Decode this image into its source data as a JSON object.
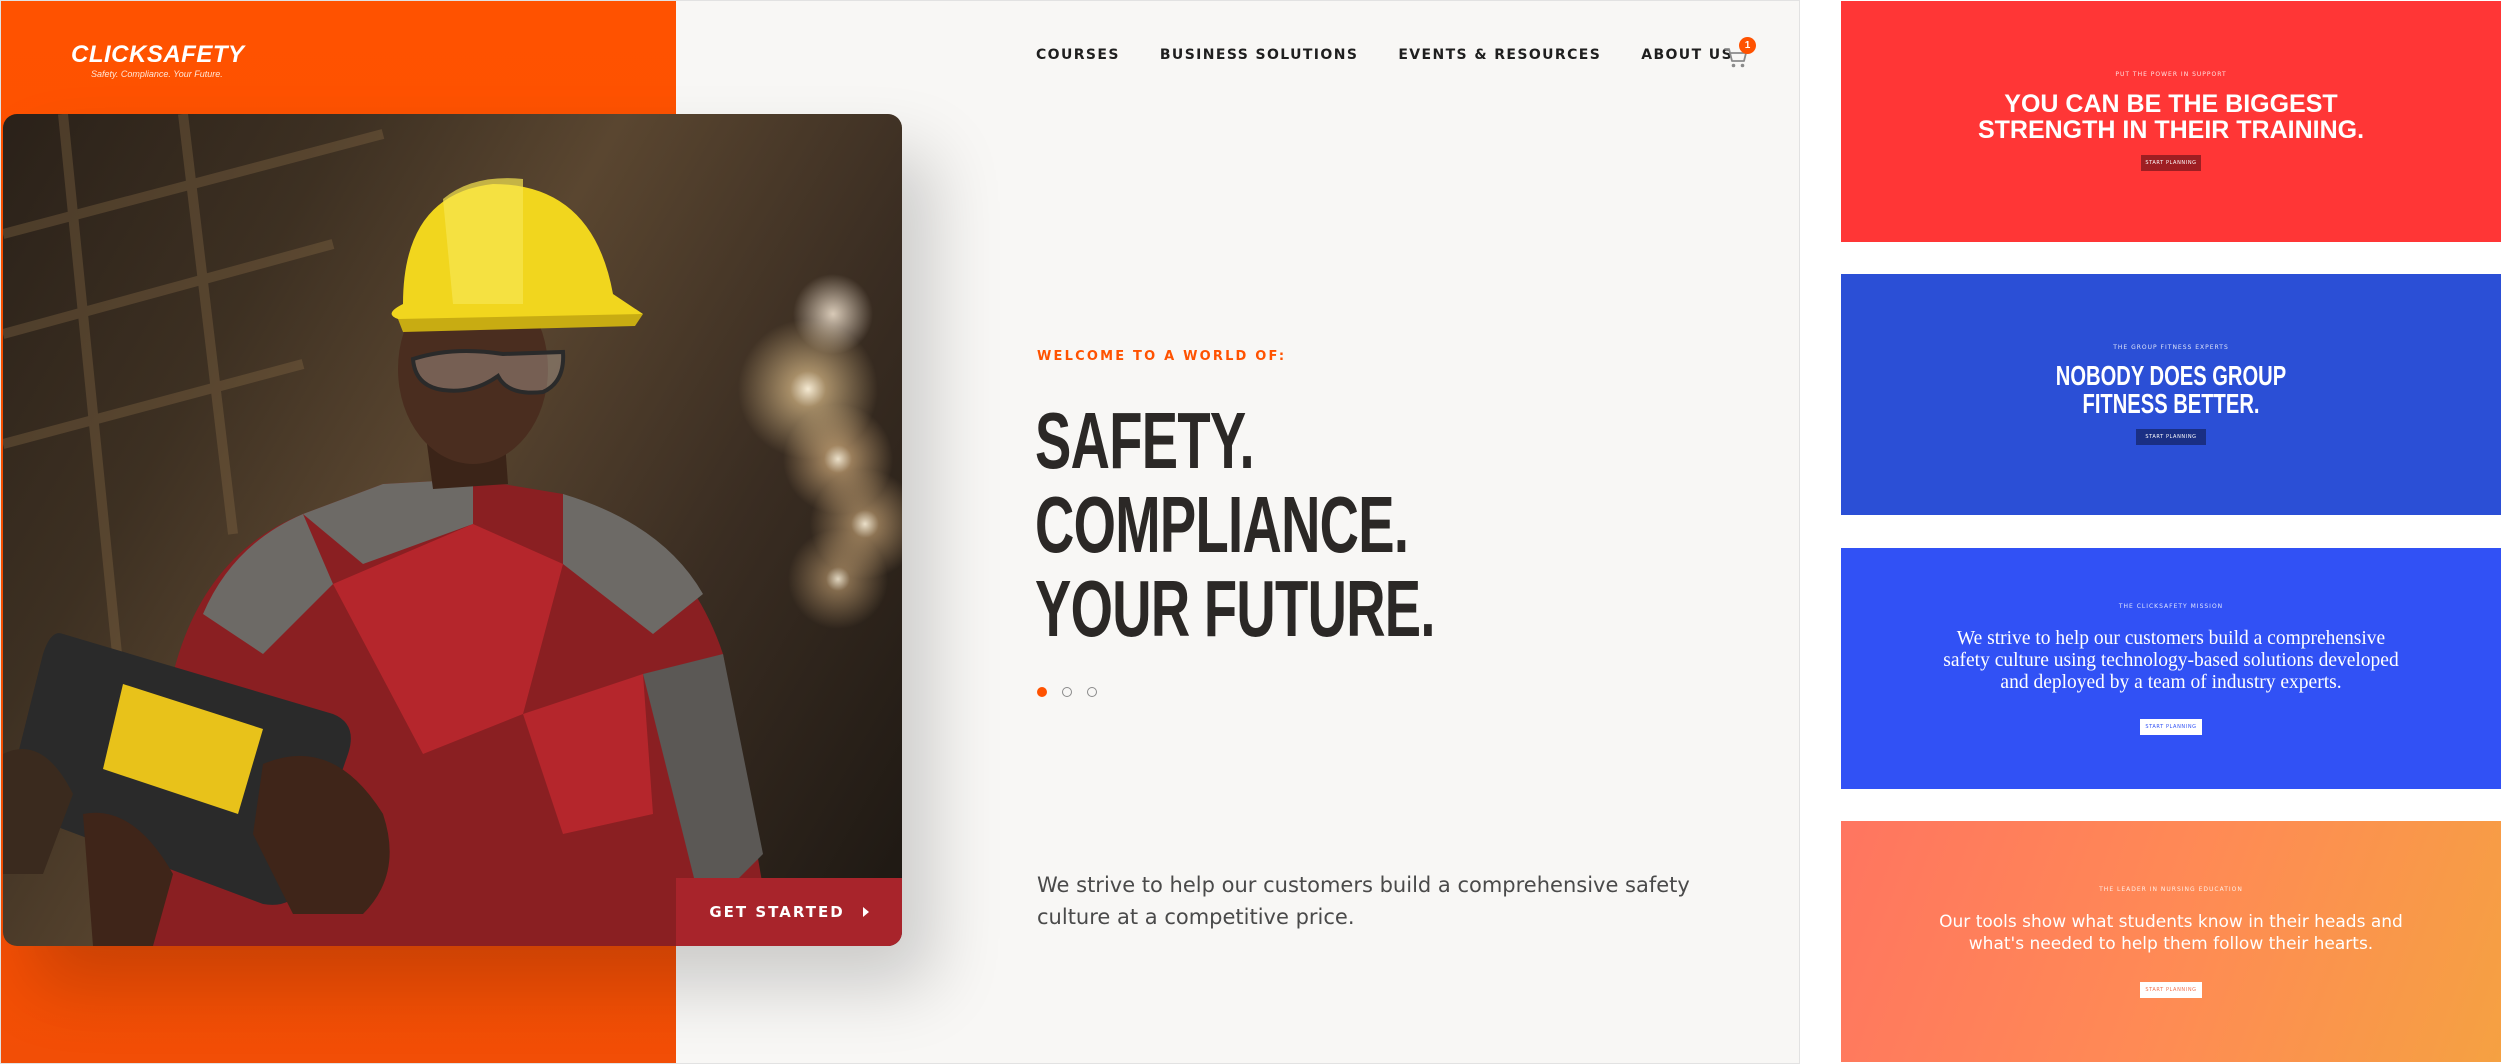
{
  "site": {
    "logo": {
      "name": "CLICKSAFETY",
      "tagline": "Safety. Compliance. Your Future."
    },
    "nav": [
      "COURSES",
      "BUSINESS SOLUTIONS",
      "EVENTS & RESOURCES",
      "ABOUT US"
    ],
    "cart": {
      "icon": "shopping-cart-icon",
      "count": "1"
    },
    "hero": {
      "eyebrow": "WELCOME TO A WORLD OF:",
      "headline": [
        "SAFETY.",
        "COMPLIANCE.",
        "YOUR FUTURE."
      ],
      "slides": {
        "total": 3,
        "active": 1
      },
      "cta": "GET STARTED",
      "cta_icon": "caret-right-icon",
      "lede": "We strive to help our customers build a comprehensive safety culture at a competitive price."
    }
  },
  "banners": [
    {
      "eyebrow": "PUT THE POWER IN SUPPORT",
      "headline": "YOU CAN BE THE BIGGEST\nSTRENGTH IN THEIR TRAINING.",
      "button": "START PLANNING",
      "color": "#ff3636"
    },
    {
      "eyebrow": "THE GROUP FITNESS EXPERTS",
      "headline": "NOBODY DOES GROUP\nFITNESS BETTER.",
      "button": "START PLANNING",
      "color": "#2b4fd6"
    },
    {
      "eyebrow": "THE CLICKSAFETY MISSION",
      "headline": "We strive to help our customers build a comprehensive\nsafety culture using technology-based solutions developed\nand deployed by a team of industry experts.",
      "button": "START PLANNING",
      "color": "#3151f5"
    },
    {
      "eyebrow": "THE LEADER IN NURSING EDUCATION",
      "headline": "Our tools show what students know in their heads and\nwhat's needed to help them follow their hearts.",
      "button": "START PLANNING",
      "color": "#ff8a55"
    }
  ],
  "colors": {
    "brand_orange": "#ff5200",
    "cta_red": "#a8242b",
    "ink": "#2b2826"
  }
}
